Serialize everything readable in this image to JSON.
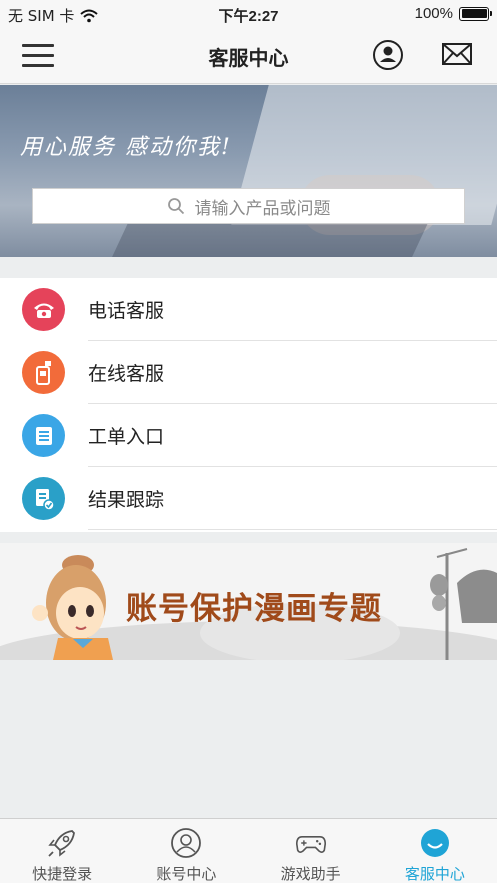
{
  "status_bar": {
    "carrier": "无 SIM 卡",
    "time": "下午2:27",
    "battery": "100%"
  },
  "nav": {
    "title": "客服中心"
  },
  "banner": {
    "slogan": "用心服务 感动你我!",
    "search_placeholder": "请输入产品或问题"
  },
  "services": [
    {
      "label": "电话客服",
      "icon": "phone-icon",
      "color": "#e5435a"
    },
    {
      "label": "在线客服",
      "icon": "online-chat-icon",
      "color": "#f26b3a"
    },
    {
      "label": "工单入口",
      "icon": "ticket-icon",
      "color": "#3aa6e6"
    },
    {
      "label": "结果跟踪",
      "icon": "tracking-icon",
      "color": "#2aa0c8"
    }
  ],
  "promo": {
    "title": "账号保护漫画专题"
  },
  "tabs": [
    {
      "label": "快捷登录",
      "icon": "rocket-icon",
      "active": false
    },
    {
      "label": "账号中心",
      "icon": "account-icon",
      "active": false
    },
    {
      "label": "游戏助手",
      "icon": "gamepad-icon",
      "active": false
    },
    {
      "label": "客服中心",
      "icon": "service-icon",
      "active": true
    }
  ],
  "colors": {
    "accent": "#1fa4d6",
    "promo_text": "#a04a1a"
  }
}
